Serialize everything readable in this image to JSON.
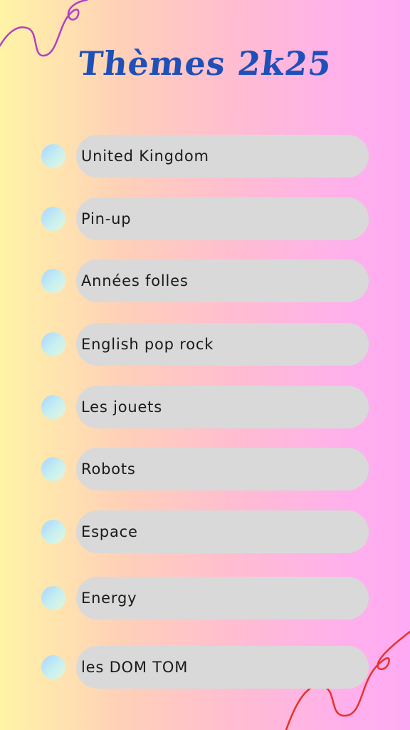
{
  "title": "Thèmes 2k25",
  "items": [
    {
      "label": "United Kingdom"
    },
    {
      "label": "Pin-up"
    },
    {
      "label": "Années folles"
    },
    {
      "label": "English pop rock"
    },
    {
      "label": "Les jouets"
    },
    {
      "label": "Robots"
    },
    {
      "label": "Espace"
    },
    {
      "label": "Energy"
    },
    {
      "label": "les DOM TOM"
    }
  ],
  "colors": {
    "title": "#1f4fb8",
    "pill": "#d9d9d9",
    "squiggle_top": "#b23fc4",
    "squiggle_bottom": "#e8322a"
  },
  "icons": {
    "bullet": "gradient-circle-bullet",
    "decoration_top": "purple-squiggle",
    "decoration_bottom": "red-squiggle"
  }
}
